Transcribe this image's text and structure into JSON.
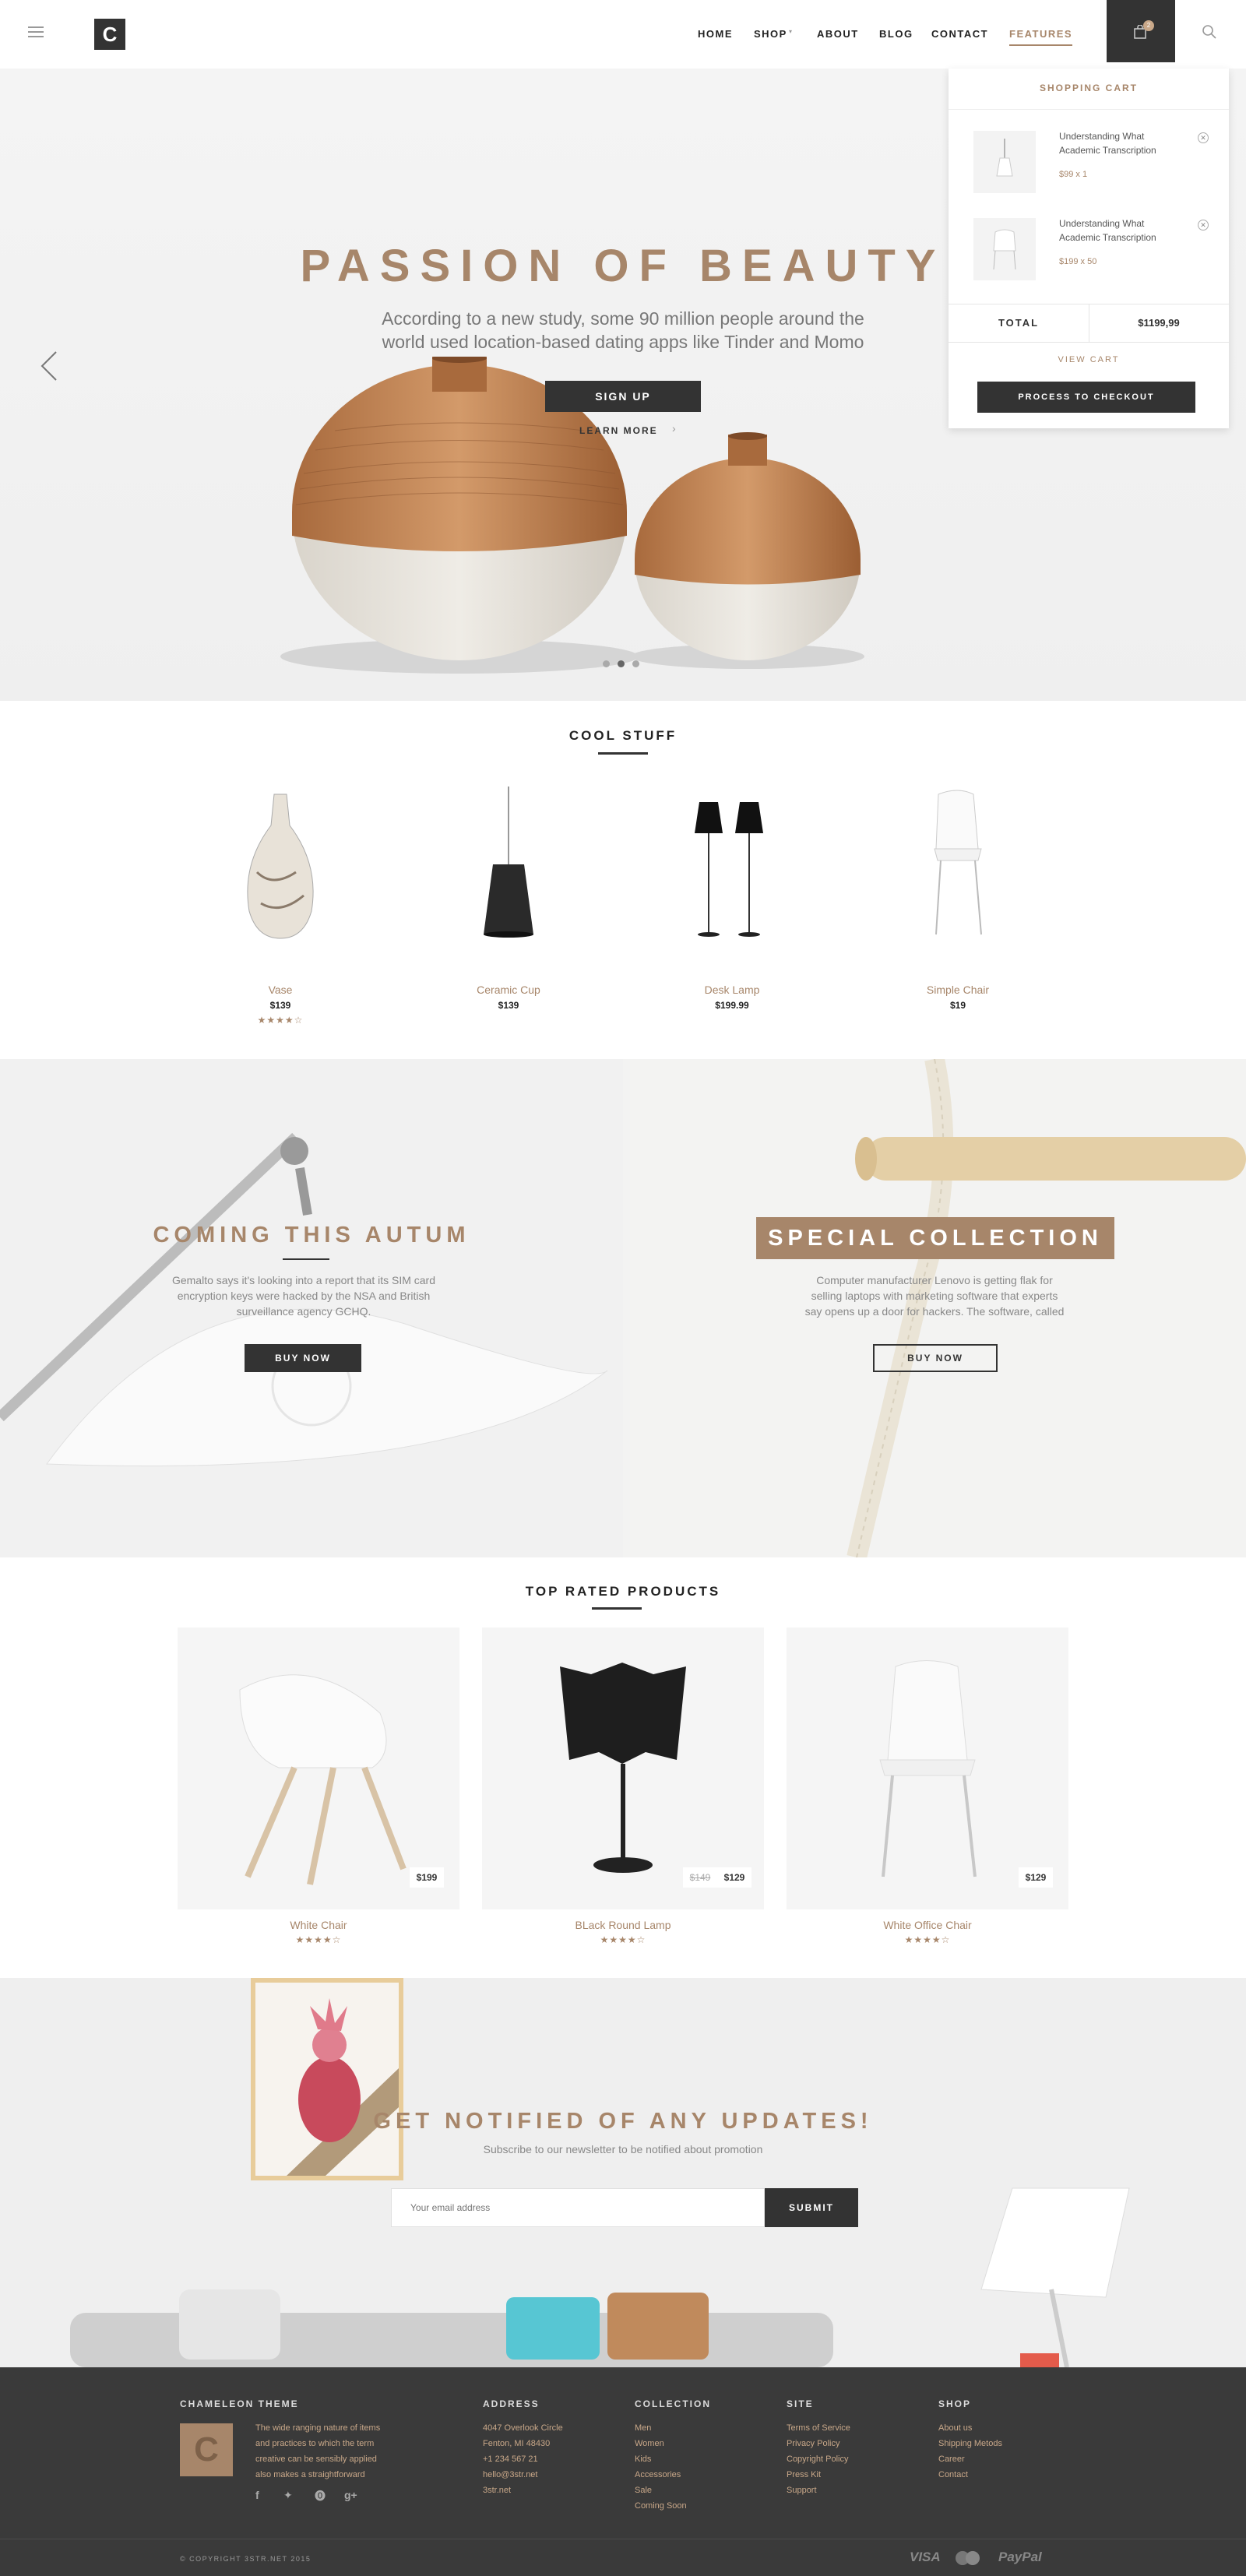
{
  "header": {
    "logo_letter": "C",
    "nav": [
      "HOME",
      "SHOP",
      "ABOUT",
      "BLOG",
      "CONTACT",
      "FEATURES"
    ],
    "cart_count": "2"
  },
  "hero": {
    "title": "PASSION OF BEAUTY",
    "subtitle_line1": "According to a new study, some 90 million people around the",
    "subtitle_line2": "world used location-based dating apps like Tinder and Momo",
    "signup": "SIGN UP",
    "learn_more": "LEARN MORE",
    "slide_count": 3,
    "active_slide": 2
  },
  "cart": {
    "title": "SHOPPING CART",
    "items": [
      {
        "name_line1": "Understanding What",
        "name_line2": "Academic Transcription",
        "price": "$99 x 1"
      },
      {
        "name_line1": "Understanding What",
        "name_line2": "Academic Transcription",
        "price": "$199 x 50"
      }
    ],
    "total_label": "TOTAL",
    "total_value": "$1199,99",
    "view_cart": "VIEW CART",
    "checkout": "PROCESS TO CHECKOUT"
  },
  "cool_stuff": {
    "title": "COOL STUFF",
    "items": [
      {
        "name": "Vase",
        "price": "$139",
        "rating": 4
      },
      {
        "name": "Ceramic Cup",
        "price": "$139"
      },
      {
        "name": "Desk Lamp",
        "price": "$199.99"
      },
      {
        "name": "Simple Chair",
        "price": "$19"
      }
    ]
  },
  "promo_left": {
    "title": "COMING THIS AUTUM",
    "text_line1": "Gemalto says it's looking into a report that its SIM card",
    "text_line2": "encryption keys were hacked by the NSA and British",
    "text_line3": "surveillance agency GCHQ.",
    "button": "BUY NOW"
  },
  "promo_right": {
    "title": "SPECIAL COLLECTION",
    "text_line1": "Computer manufacturer Lenovo is getting flak for",
    "text_line2": "selling laptops with marketing software that experts",
    "text_line3": "say opens up a door for hackers. The software, called",
    "button": "BUY NOW"
  },
  "top_rated": {
    "title": "TOP RATED PRODUCTS",
    "items": [
      {
        "name": "White Chair",
        "price": "$199",
        "old_price": "",
        "rating": 4
      },
      {
        "name": "BLack Round Lamp",
        "price": "$129",
        "old_price": "$149",
        "rating": 4
      },
      {
        "name": "White Office Chair",
        "price": "$129",
        "old_price": "",
        "rating": 4
      }
    ]
  },
  "newsletter": {
    "title": "GET NOTIFIED OF ANY UPDATES!",
    "subtitle": "Subscribe to our newsletter to be notified about promotion",
    "placeholder": "Your email address",
    "submit": "SUBMIT"
  },
  "footer": {
    "brand_title": "CHAMELEON THEME",
    "brand_letter": "C",
    "brand_text": [
      "The wide ranging nature of items",
      "and practices to which the term",
      "creative can be sensibly applied",
      "also makes a straightforward"
    ],
    "address_title": "ADDRESS",
    "address": [
      "4047 Overlook Circle",
      "Fenton, MI 48430",
      "+1 234 567 21",
      "hello@3str.net",
      "3str.net"
    ],
    "collection_title": "COLLECTION",
    "collection": [
      "Men",
      "Women",
      "Kids",
      "Accessories",
      "Sale",
      "Coming Soon"
    ],
    "site_title": "SITE",
    "site": [
      "Terms of Service",
      "Privacy Policy",
      "Copyright Policy",
      "Press Kit",
      "Support"
    ],
    "shop_title": "SHOP",
    "shop": [
      "About us",
      "Shipping Metods",
      "Career",
      "Contact"
    ],
    "copyright": "© COPYRIGHT 3STR.NET 2015",
    "payments": [
      "VISA",
      "PayPal"
    ],
    "social_icons": [
      "facebook-icon",
      "twitter-icon",
      "pinterest-icon",
      "google-plus-icon"
    ]
  },
  "colors": {
    "accent": "#a7866a",
    "dark": "#333333",
    "footer": "#3a3a3a"
  }
}
